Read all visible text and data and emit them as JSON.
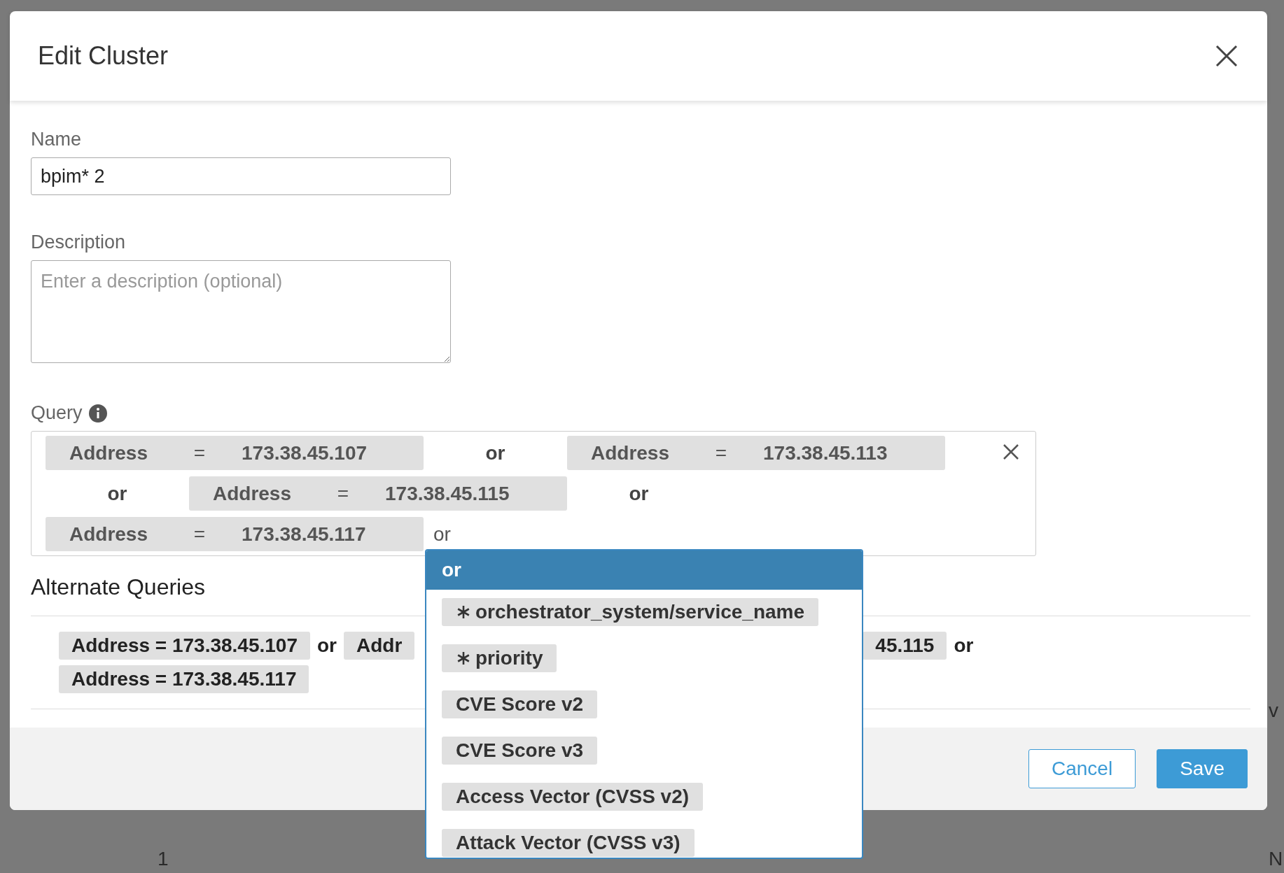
{
  "background": {
    "right_fragments": [
      "v",
      "N"
    ],
    "bottom_fragments": [
      "1"
    ]
  },
  "dialog": {
    "title": "Edit Cluster",
    "name": {
      "label": "Name",
      "value": "bpim* 2"
    },
    "description": {
      "label": "Description",
      "placeholder": "Enter a description (optional)"
    },
    "query": {
      "label": "Query",
      "rows": [
        [
          {
            "kind": "chip",
            "field": "Address",
            "op": "=",
            "value": "173.38.45.107"
          },
          {
            "kind": "or",
            "text": "or"
          },
          {
            "kind": "chip",
            "field": "Address",
            "op": "=",
            "value": "173.38.45.113"
          }
        ],
        [
          {
            "kind": "or",
            "text": "or"
          },
          {
            "kind": "chip",
            "field": "Address",
            "op": "=",
            "value": "173.38.45.115"
          },
          {
            "kind": "or",
            "text": "or"
          }
        ],
        [
          {
            "kind": "chip",
            "field": "Address",
            "op": "=",
            "value": "173.38.45.117"
          },
          {
            "kind": "input",
            "text": "or"
          }
        ]
      ]
    },
    "alternate": {
      "title": "Alternate Queries",
      "rows": [
        [
          {
            "kind": "chip",
            "text": "Address = 173.38.45.107"
          },
          {
            "kind": "or",
            "text": "or"
          },
          {
            "kind": "chip",
            "text": "Addr"
          },
          {
            "kind": "gap"
          },
          {
            "kind": "chip",
            "text": "45.115"
          },
          {
            "kind": "or",
            "text": "or"
          }
        ],
        [
          {
            "kind": "chip",
            "text": "Address = 173.38.45.117"
          }
        ]
      ]
    },
    "buttons": [
      {
        "label": "Cancel",
        "kind": "secondary"
      },
      {
        "label": "Save",
        "kind": "primary"
      }
    ],
    "dropdown": {
      "header": "or",
      "items": [
        {
          "label": "orchestrator_system/service_name",
          "starred": true
        },
        {
          "label": "priority",
          "starred": true
        },
        {
          "label": "CVE Score v2",
          "starred": false
        },
        {
          "label": "CVE Score v3",
          "starred": false
        },
        {
          "label": "Access Vector (CVSS v2)",
          "starred": false
        },
        {
          "label": "Attack Vector (CVSS v3)",
          "starred": false
        }
      ]
    }
  }
}
